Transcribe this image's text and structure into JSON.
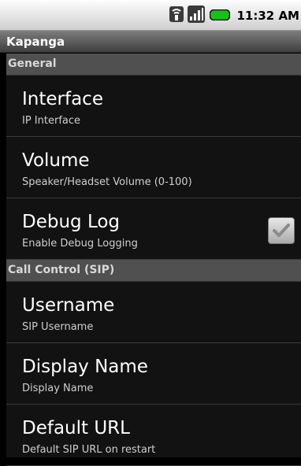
{
  "status": {
    "time": "11:32 AM"
  },
  "title": "Kapanga",
  "sections": [
    {
      "title": "General",
      "items": [
        {
          "title": "Interface",
          "summary": "IP Interface"
        },
        {
          "title": "Volume",
          "summary": "Speaker/Headset Volume (0-100)"
        },
        {
          "title": "Debug Log",
          "summary": "Enable Debug Logging",
          "checkbox": "checked"
        }
      ]
    },
    {
      "title": "Call Control (SIP)",
      "items": [
        {
          "title": "Username",
          "summary": "SIP Username"
        },
        {
          "title": "Display Name",
          "summary": "Display Name"
        },
        {
          "title": "Default URL",
          "summary": "Default SIP URL on restart"
        }
      ]
    }
  ]
}
